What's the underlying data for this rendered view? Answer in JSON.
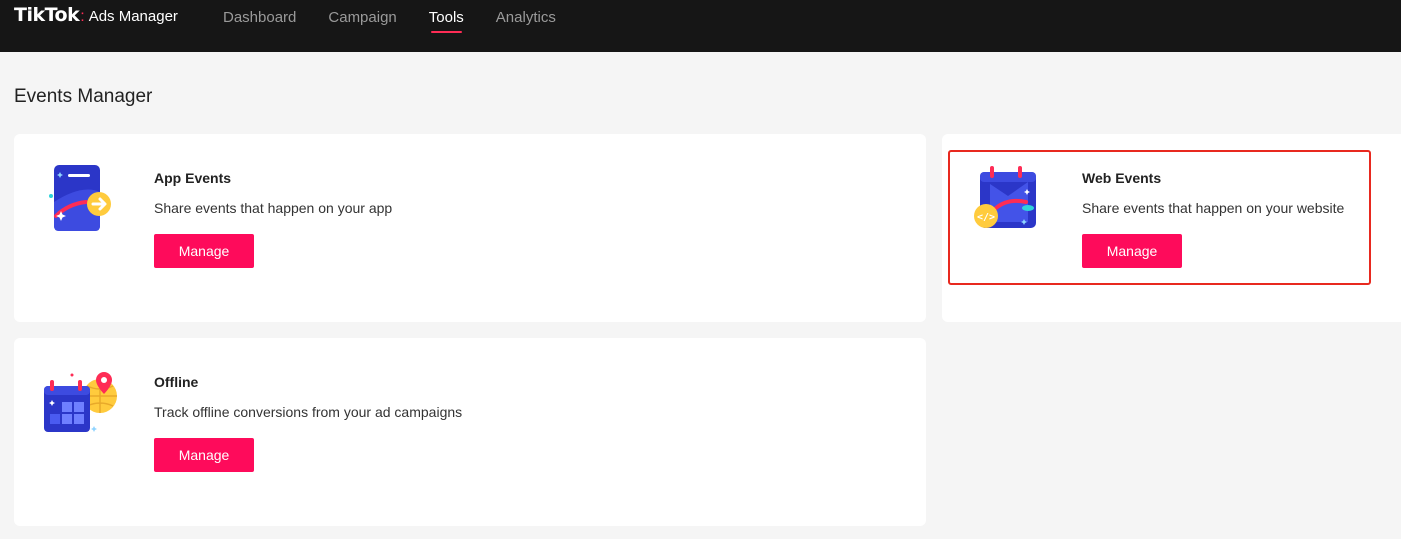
{
  "header": {
    "brand": "TikTok",
    "product": "Ads Manager",
    "nav": [
      {
        "label": "Dashboard",
        "active": false
      },
      {
        "label": "Campaign",
        "active": false
      },
      {
        "label": "Tools",
        "active": true
      },
      {
        "label": "Analytics",
        "active": false
      }
    ]
  },
  "page": {
    "title": "Events Manager"
  },
  "cards": [
    {
      "icon": "app-events-icon",
      "title": "App Events",
      "description": "Share events that happen on your app",
      "button": "Manage"
    },
    {
      "icon": "web-events-icon",
      "title": "Web Events",
      "description": "Share events that happen on your website",
      "button": "Manage"
    },
    {
      "icon": "offline-events-icon",
      "title": "Offline",
      "description": "Track offline conversions from your ad campaigns",
      "button": "Manage"
    }
  ],
  "colors": {
    "topbar": "#161616",
    "accent": "#fe2c55",
    "button": "#fe0b5b",
    "highlight": "#e8291f",
    "background": "#f5f5f5"
  }
}
